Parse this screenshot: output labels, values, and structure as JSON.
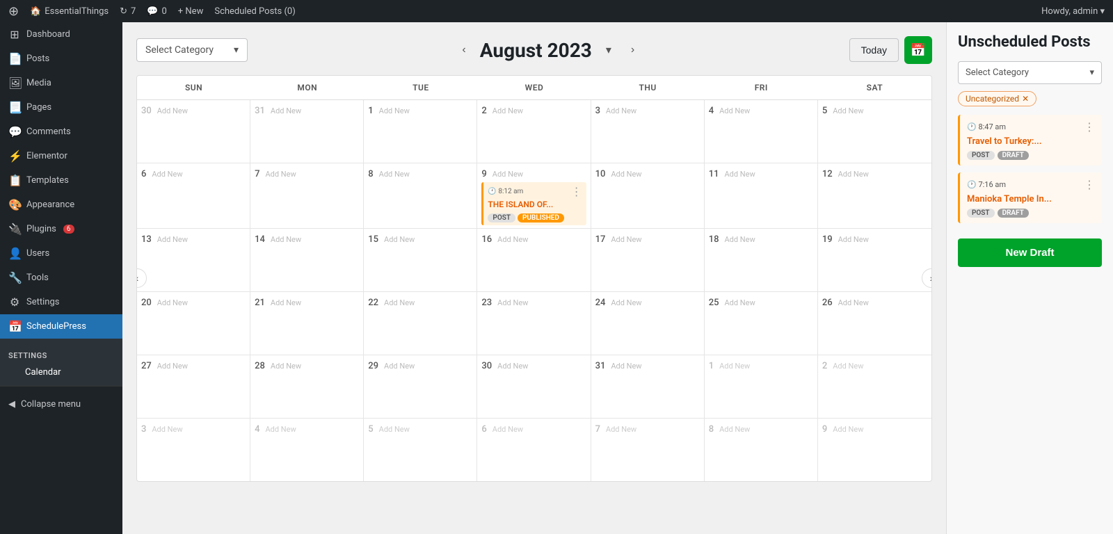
{
  "adminbar": {
    "logo": "⊕",
    "site_name": "EssentialThings",
    "updates": "7",
    "comments": "0",
    "new_label": "+ New",
    "scheduled_label": "Scheduled Posts (0)",
    "howdy": "Howdy, admin ▾"
  },
  "sidebar": {
    "items": [
      {
        "id": "dashboard",
        "label": "Dashboard",
        "icon": "⊞"
      },
      {
        "id": "posts",
        "label": "Posts",
        "icon": "📄"
      },
      {
        "id": "media",
        "label": "Media",
        "icon": "🖼"
      },
      {
        "id": "pages",
        "label": "Pages",
        "icon": "📃"
      },
      {
        "id": "comments",
        "label": "Comments",
        "icon": "💬"
      },
      {
        "id": "elementor",
        "label": "Elementor",
        "icon": "⚡"
      },
      {
        "id": "templates",
        "label": "Templates",
        "icon": "📋"
      },
      {
        "id": "appearance",
        "label": "Appearance",
        "icon": "🎨"
      },
      {
        "id": "plugins",
        "label": "Plugins",
        "icon": "🔌",
        "badge": "6"
      },
      {
        "id": "users",
        "label": "Users",
        "icon": "👤"
      },
      {
        "id": "tools",
        "label": "Tools",
        "icon": "🔧"
      },
      {
        "id": "settings",
        "label": "Settings",
        "icon": "⚙"
      },
      {
        "id": "schedulepress",
        "label": "SchedulePress",
        "icon": "📅",
        "active": true
      }
    ],
    "settings_section": "Settings",
    "calendar_item": "Calendar",
    "collapse_label": "Collapse menu"
  },
  "calendar": {
    "category_placeholder": "Select Category",
    "month_year": "August 2023",
    "today_label": "Today",
    "days": [
      "SUN",
      "MON",
      "TUE",
      "WED",
      "THU",
      "FRI",
      "SAT"
    ],
    "weeks": [
      [
        {
          "num": "30",
          "muted": true,
          "addNew": true
        },
        {
          "num": "31",
          "muted": true,
          "addNew": true
        },
        {
          "num": "1",
          "addNew": true
        },
        {
          "num": "2",
          "addNew": true
        },
        {
          "num": "3",
          "addNew": true
        },
        {
          "num": "4",
          "addNew": true
        },
        {
          "num": "5",
          "addNew": true
        }
      ],
      [
        {
          "num": "6",
          "addNew": true
        },
        {
          "num": "7",
          "addNew": true
        },
        {
          "num": "8",
          "addNew": true
        },
        {
          "num": "9",
          "addNew": true,
          "hasPost": true,
          "postTime": "8:12 am",
          "postTitle": "THE ISLAND OF...",
          "postTags": [
            "POST",
            "PUBLISHED"
          ]
        },
        {
          "num": "10",
          "addNew": true
        },
        {
          "num": "11",
          "addNew": true
        },
        {
          "num": "12",
          "addNew": true
        }
      ],
      [
        {
          "num": "13",
          "addNew": true
        },
        {
          "num": "14",
          "addNew": true
        },
        {
          "num": "15",
          "addNew": true
        },
        {
          "num": "16",
          "addNew": true
        },
        {
          "num": "17",
          "addNew": true
        },
        {
          "num": "18",
          "addNew": true
        },
        {
          "num": "19",
          "addNew": true
        }
      ],
      [
        {
          "num": "20",
          "addNew": true
        },
        {
          "num": "21",
          "addNew": true
        },
        {
          "num": "22",
          "addNew": true
        },
        {
          "num": "23",
          "addNew": true
        },
        {
          "num": "24",
          "addNew": true
        },
        {
          "num": "25",
          "addNew": true
        },
        {
          "num": "26",
          "addNew": true
        }
      ],
      [
        {
          "num": "27",
          "addNew": true
        },
        {
          "num": "28",
          "addNew": true
        },
        {
          "num": "29",
          "addNew": true
        },
        {
          "num": "30",
          "addNew": true
        },
        {
          "num": "31",
          "addNew": true
        },
        {
          "num": "1",
          "muted": true,
          "addNew": true
        },
        {
          "num": "2",
          "muted": true,
          "addNew": true
        }
      ],
      [
        {
          "num": "3",
          "muted": true,
          "addNew": true
        },
        {
          "num": "4",
          "muted": true,
          "addNew": true
        },
        {
          "num": "5",
          "muted": true,
          "addNew": true
        },
        {
          "num": "6",
          "muted": true,
          "addNew": true
        },
        {
          "num": "7",
          "muted": true,
          "addNew": true
        },
        {
          "num": "8",
          "muted": true,
          "addNew": true
        },
        {
          "num": "9",
          "muted": true,
          "addNew": true
        }
      ]
    ]
  },
  "right_panel": {
    "title": "Unscheduled Posts",
    "category_placeholder": "Select Category",
    "uncategorized_label": "Uncategorized",
    "posts": [
      {
        "time": "8:47 am",
        "title": "Travel to Turkey:...",
        "tags": [
          "POST",
          "DRAFT"
        ]
      },
      {
        "time": "7:16 am",
        "title": "Manioka Temple In...",
        "tags": [
          "POST",
          "DRAFT"
        ]
      }
    ],
    "new_draft_label": "New Draft"
  }
}
